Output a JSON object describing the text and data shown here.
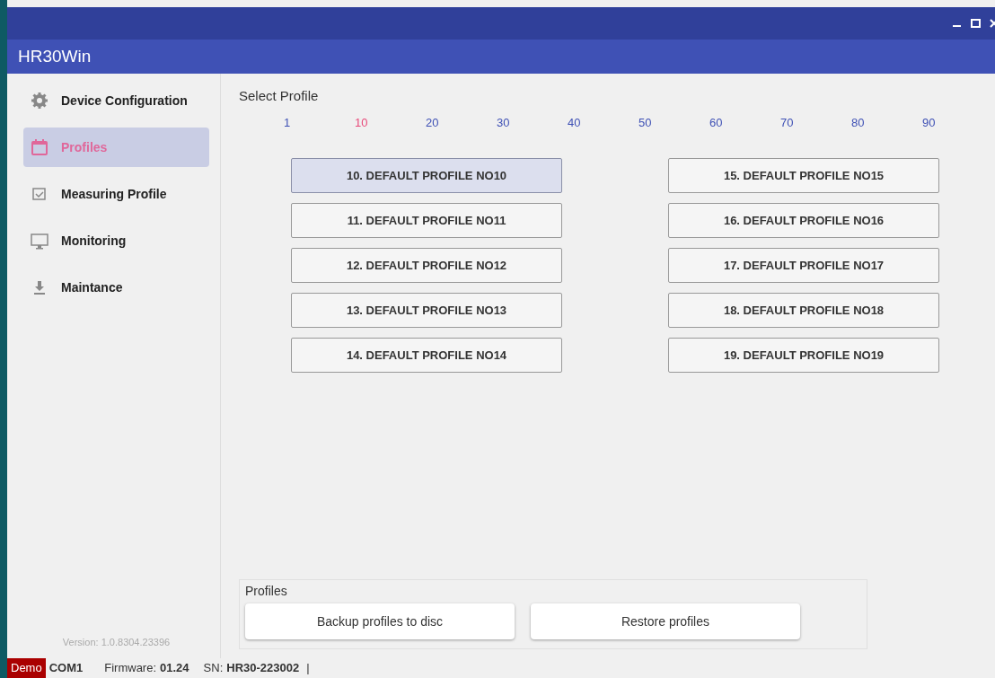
{
  "window": {
    "title": "HR30Win"
  },
  "sidebar": {
    "items": [
      {
        "label": "Device Configuration",
        "selected": false
      },
      {
        "label": "Profiles",
        "selected": true
      },
      {
        "label": "Measuring Profile",
        "selected": false
      },
      {
        "label": "Monitoring",
        "selected": false
      },
      {
        "label": "Maintance",
        "selected": false
      }
    ],
    "version": "Version: 1.0.8304.23396"
  },
  "select_profile": {
    "title": "Select Profile",
    "ranges": [
      {
        "label": "1",
        "selected": false
      },
      {
        "label": "10",
        "selected": true
      },
      {
        "label": "20",
        "selected": false
      },
      {
        "label": "30",
        "selected": false
      },
      {
        "label": "40",
        "selected": false
      },
      {
        "label": "50",
        "selected": false
      },
      {
        "label": "60",
        "selected": false
      },
      {
        "label": "70",
        "selected": false
      },
      {
        "label": "80",
        "selected": false
      },
      {
        "label": "90",
        "selected": false
      }
    ],
    "profiles": [
      {
        "label": "10. DEFAULT PROFILE NO10",
        "selected": true
      },
      {
        "label": "11. DEFAULT PROFILE NO11",
        "selected": false
      },
      {
        "label": "12. DEFAULT PROFILE NO12",
        "selected": false
      },
      {
        "label": "13. DEFAULT PROFILE NO13",
        "selected": false
      },
      {
        "label": "14. DEFAULT PROFILE NO14",
        "selected": false
      },
      {
        "label": "15. DEFAULT PROFILE NO15",
        "selected": false
      },
      {
        "label": "16. DEFAULT PROFILE NO16",
        "selected": false
      },
      {
        "label": "17. DEFAULT PROFILE NO17",
        "selected": false
      },
      {
        "label": "18. DEFAULT PROFILE NO18",
        "selected": false
      },
      {
        "label": "19. DEFAULT PROFILE NO19",
        "selected": false
      }
    ]
  },
  "profiles_group": {
    "title": "Profiles",
    "buttons": [
      "Backup profiles to disc",
      "Restore profiles"
    ]
  },
  "status_bar": {
    "mode": "Demo",
    "port": "COM1",
    "firmware_label": "Firmware:",
    "firmware": "01.24",
    "sn_label": "SN:",
    "sn": "HR30-223002",
    "separator": "|"
  }
}
